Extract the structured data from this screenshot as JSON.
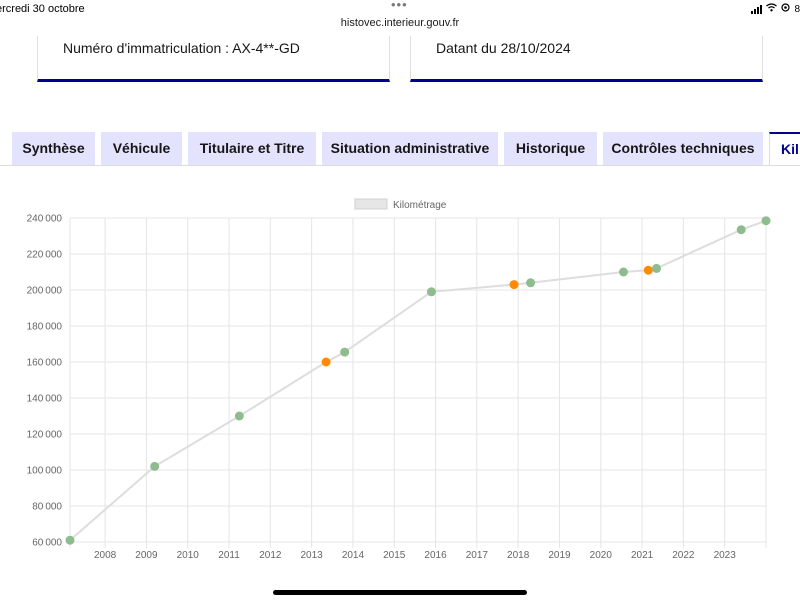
{
  "status_bar": {
    "date": "ercredi 30 octobre",
    "url": "histovec.interieur.gouv.fr",
    "battery": "8"
  },
  "cards": {
    "registration": "Numéro d'immatriculation : AX-4**-GD",
    "date": "Datant du 28/10/2024"
  },
  "tabs": [
    {
      "label": "Synthèse"
    },
    {
      "label": "Véhicule"
    },
    {
      "label": "Titulaire et Titre"
    },
    {
      "label": "Situation administrative"
    },
    {
      "label": "Historique"
    },
    {
      "label": "Contrôles techniques"
    },
    {
      "label": "Kil",
      "active": true
    }
  ],
  "colors": {
    "ok": "#8fbc8f",
    "warning": "#ff8c00",
    "line": "#dddddd",
    "tab_bg": "#e3e3fd",
    "accent": "#000091"
  },
  "chart_data": {
    "type": "line",
    "legend": [
      "Kilométrage"
    ],
    "legend_position": "top-center",
    "grid": true,
    "x_ticks": [
      "2008",
      "2009",
      "2010",
      "2011",
      "2012",
      "2013",
      "2014",
      "2015",
      "2016",
      "2017",
      "2018",
      "2019",
      "2020",
      "2021",
      "2022",
      "2023"
    ],
    "y_ticks": [
      "60000",
      "80000",
      "100000",
      "120000",
      "140000",
      "160000",
      "180000",
      "200000",
      "220000",
      "240000"
    ],
    "ylim": [
      60000,
      240000
    ],
    "xlim": [
      2007.15,
      2024.0
    ],
    "series": [
      {
        "name": "Kilométrage",
        "points": [
          {
            "x": 2007.15,
            "y": 61000,
            "status": "ok"
          },
          {
            "x": 2009.2,
            "y": 102000,
            "status": "ok"
          },
          {
            "x": 2011.25,
            "y": 130000,
            "status": "ok"
          },
          {
            "x": 2013.35,
            "y": 160000,
            "status": "warning"
          },
          {
            "x": 2013.8,
            "y": 165500,
            "status": "ok"
          },
          {
            "x": 2015.9,
            "y": 199000,
            "status": "ok"
          },
          {
            "x": 2017.9,
            "y": 203000,
            "status": "warning"
          },
          {
            "x": 2018.3,
            "y": 204000,
            "status": "ok"
          },
          {
            "x": 2020.55,
            "y": 210000,
            "status": "ok"
          },
          {
            "x": 2021.15,
            "y": 211000,
            "status": "warning"
          },
          {
            "x": 2021.35,
            "y": 212000,
            "status": "ok"
          },
          {
            "x": 2023.4,
            "y": 233500,
            "status": "ok"
          },
          {
            "x": 2024.0,
            "y": 238500,
            "status": "ok"
          }
        ]
      }
    ]
  }
}
